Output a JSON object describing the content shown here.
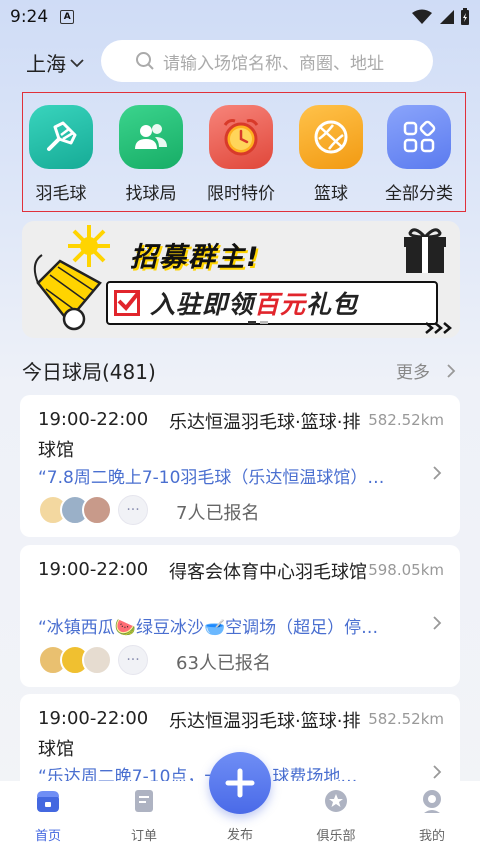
{
  "status": {
    "time": "9:24",
    "notif": "A"
  },
  "header": {
    "city": "上海",
    "search_placeholder": "请输入场馆名称、商圈、地址"
  },
  "categories": [
    {
      "label": "羽毛球",
      "icon": "shuttlecock-icon",
      "color": "#1fbfa8"
    },
    {
      "label": "找球局",
      "icon": "people-icon",
      "color": "#22c27a"
    },
    {
      "label": "限时特价",
      "icon": "alarm-clock-icon",
      "color": "#f26b5b"
    },
    {
      "label": "篮球",
      "icon": "basketball-icon",
      "color": "#f5a623"
    },
    {
      "label": "全部分类",
      "icon": "grid-icon",
      "color": "#6f8ef5"
    }
  ],
  "banner": {
    "line1": "招募群主!",
    "line2_a": "入驻即领",
    "line2_b": "百元",
    "line2_c": "礼包"
  },
  "section": {
    "title": "今日球局(481)",
    "more": "更多"
  },
  "games": [
    {
      "time": "19:00-22:00",
      "venue": "乐达恒温羽毛球·篮球·排球馆",
      "distance": "582.52km",
      "desc": "“7.8周二晚上7-10羽毛球（乐达恒温球馆）…",
      "signed": "7人已报名"
    },
    {
      "time": "19:00-22:00",
      "venue": "得客会体育中心羽毛球馆",
      "distance": "598.05km",
      "desc": "“冰镇西瓜🍉绿豆冰沙🥣空调场（超足）停…",
      "signed": "63人已报名"
    },
    {
      "time": "19:00-22:00",
      "venue": "乐达恒温羽毛球·篮球·排球馆",
      "distance": "582.52km",
      "desc": "“乐达周二晚7-10点，一份超，球费场地…",
      "signed": ""
    }
  ],
  "tabs": {
    "home": "首页",
    "orders": "订单",
    "publish": "发布",
    "club": "俱乐部",
    "mine": "我的"
  },
  "colors": {
    "accent": "#4468e0",
    "highlight_red": "#e1252c"
  }
}
